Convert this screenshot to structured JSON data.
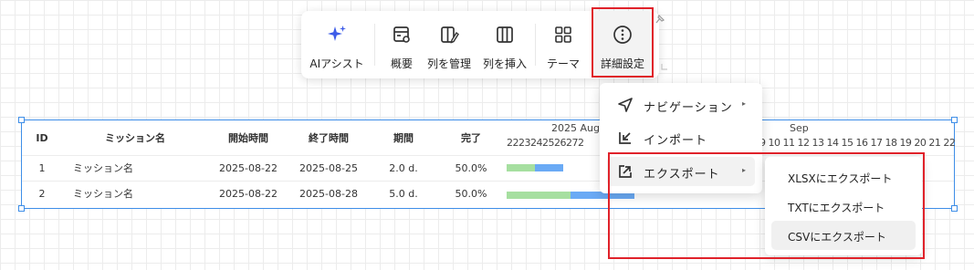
{
  "toolbar": {
    "items": [
      {
        "label": "AIアシスト",
        "icon": "sparkle-icon"
      },
      {
        "label": "概要",
        "icon": "summary-icon"
      },
      {
        "label": "列を管理",
        "icon": "manage-columns-icon"
      },
      {
        "label": "列を挿入",
        "icon": "insert-column-icon"
      },
      {
        "label": "テーマ",
        "icon": "theme-grid-icon"
      },
      {
        "label": "詳細設定",
        "icon": "more-options-icon"
      }
    ],
    "highlighted": "詳細設定"
  },
  "table": {
    "columns": [
      "ID",
      "ミッション名",
      "開始時間",
      "終了時間",
      "期間",
      "完了"
    ],
    "rows": [
      {
        "id": "1",
        "name": "ミッション名",
        "start": "2025-08-22",
        "end": "2025-08-25",
        "duration": "2.0 d.",
        "complete": "50.0%",
        "progress": 0.5
      },
      {
        "id": "2",
        "name": "ミッション名",
        "start": "2025-08-22",
        "end": "2025-08-28",
        "duration": "5.0 d.",
        "complete": "50.0%",
        "progress": 0.5
      }
    ]
  },
  "timeline": {
    "month1": "2025 Aug",
    "month1_days": "2223242526272",
    "month2": "Sep",
    "month2_days": "9 10 11 12 13 14 15 16 17 18 19 20 21 22"
  },
  "menu": {
    "items": [
      {
        "label": "ナビゲーション",
        "icon": "navigation-icon",
        "has_submenu": true
      },
      {
        "label": "インポート",
        "icon": "import-icon",
        "has_submenu": false
      },
      {
        "label": "エクスポート",
        "icon": "export-icon",
        "has_submenu": true,
        "active": true
      }
    ],
    "submenu_arrow": "▸"
  },
  "export_submenu": {
    "items": [
      {
        "label": "XLSXにエクスポート"
      },
      {
        "label": "TXTにエクスポート"
      },
      {
        "label": "CSVにエクスポート",
        "active": true
      }
    ]
  },
  "colors": {
    "accent": "#3e8ee8",
    "highlight": "#e0222a",
    "sparkle": "#3d5ce8",
    "progress_done": "#a6dfa0",
    "progress_rest": "#6aaaf5"
  }
}
